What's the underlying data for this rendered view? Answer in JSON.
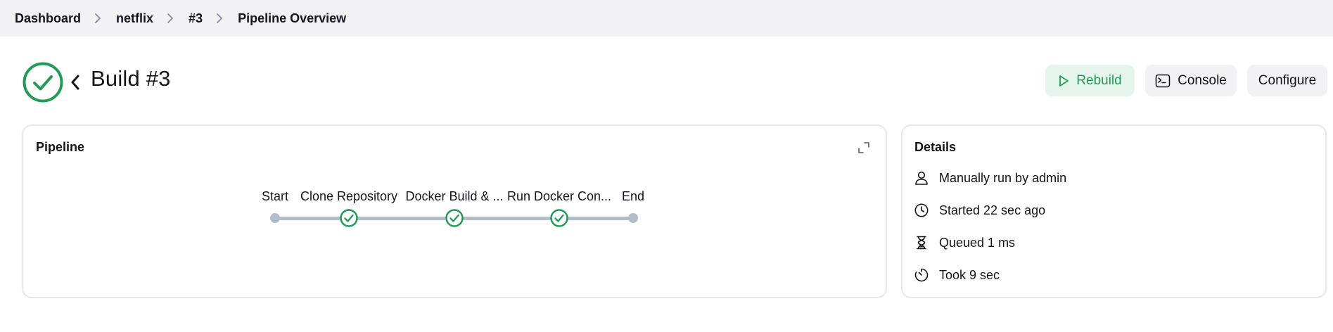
{
  "breadcrumb": {
    "items": [
      {
        "label": "Dashboard"
      },
      {
        "label": "netflix"
      },
      {
        "label": "#3"
      },
      {
        "label": "Pipeline Overview"
      }
    ]
  },
  "header": {
    "title": "Build #3",
    "status": "success",
    "buttons": {
      "rebuild": "Rebuild",
      "console": "Console",
      "configure": "Configure"
    }
  },
  "pipeline": {
    "title": "Pipeline",
    "stages": [
      {
        "label": "Start",
        "kind": "endpoint"
      },
      {
        "label": "Clone Repository",
        "kind": "stage",
        "status": "success"
      },
      {
        "label": "Docker Build & ...",
        "kind": "stage",
        "status": "success"
      },
      {
        "label": "Run Docker Con...",
        "kind": "stage",
        "status": "success"
      },
      {
        "label": "End",
        "kind": "endpoint"
      }
    ]
  },
  "details": {
    "title": "Details",
    "rows": [
      {
        "icon": "user-icon",
        "text": "Manually run by admin"
      },
      {
        "icon": "clock-icon",
        "text": "Started 22 sec ago"
      },
      {
        "icon": "hourglass-icon",
        "text": "Queued 1 ms"
      },
      {
        "icon": "timer-icon",
        "text": "Took 9 sec"
      }
    ]
  },
  "colors": {
    "success": "#1f9d55",
    "track": "#b3bcc9",
    "breadcrumb_bg": "#f2f2f4",
    "button_bg": "#f2f2f4",
    "rebuild_bg": "#e6f5ec"
  }
}
